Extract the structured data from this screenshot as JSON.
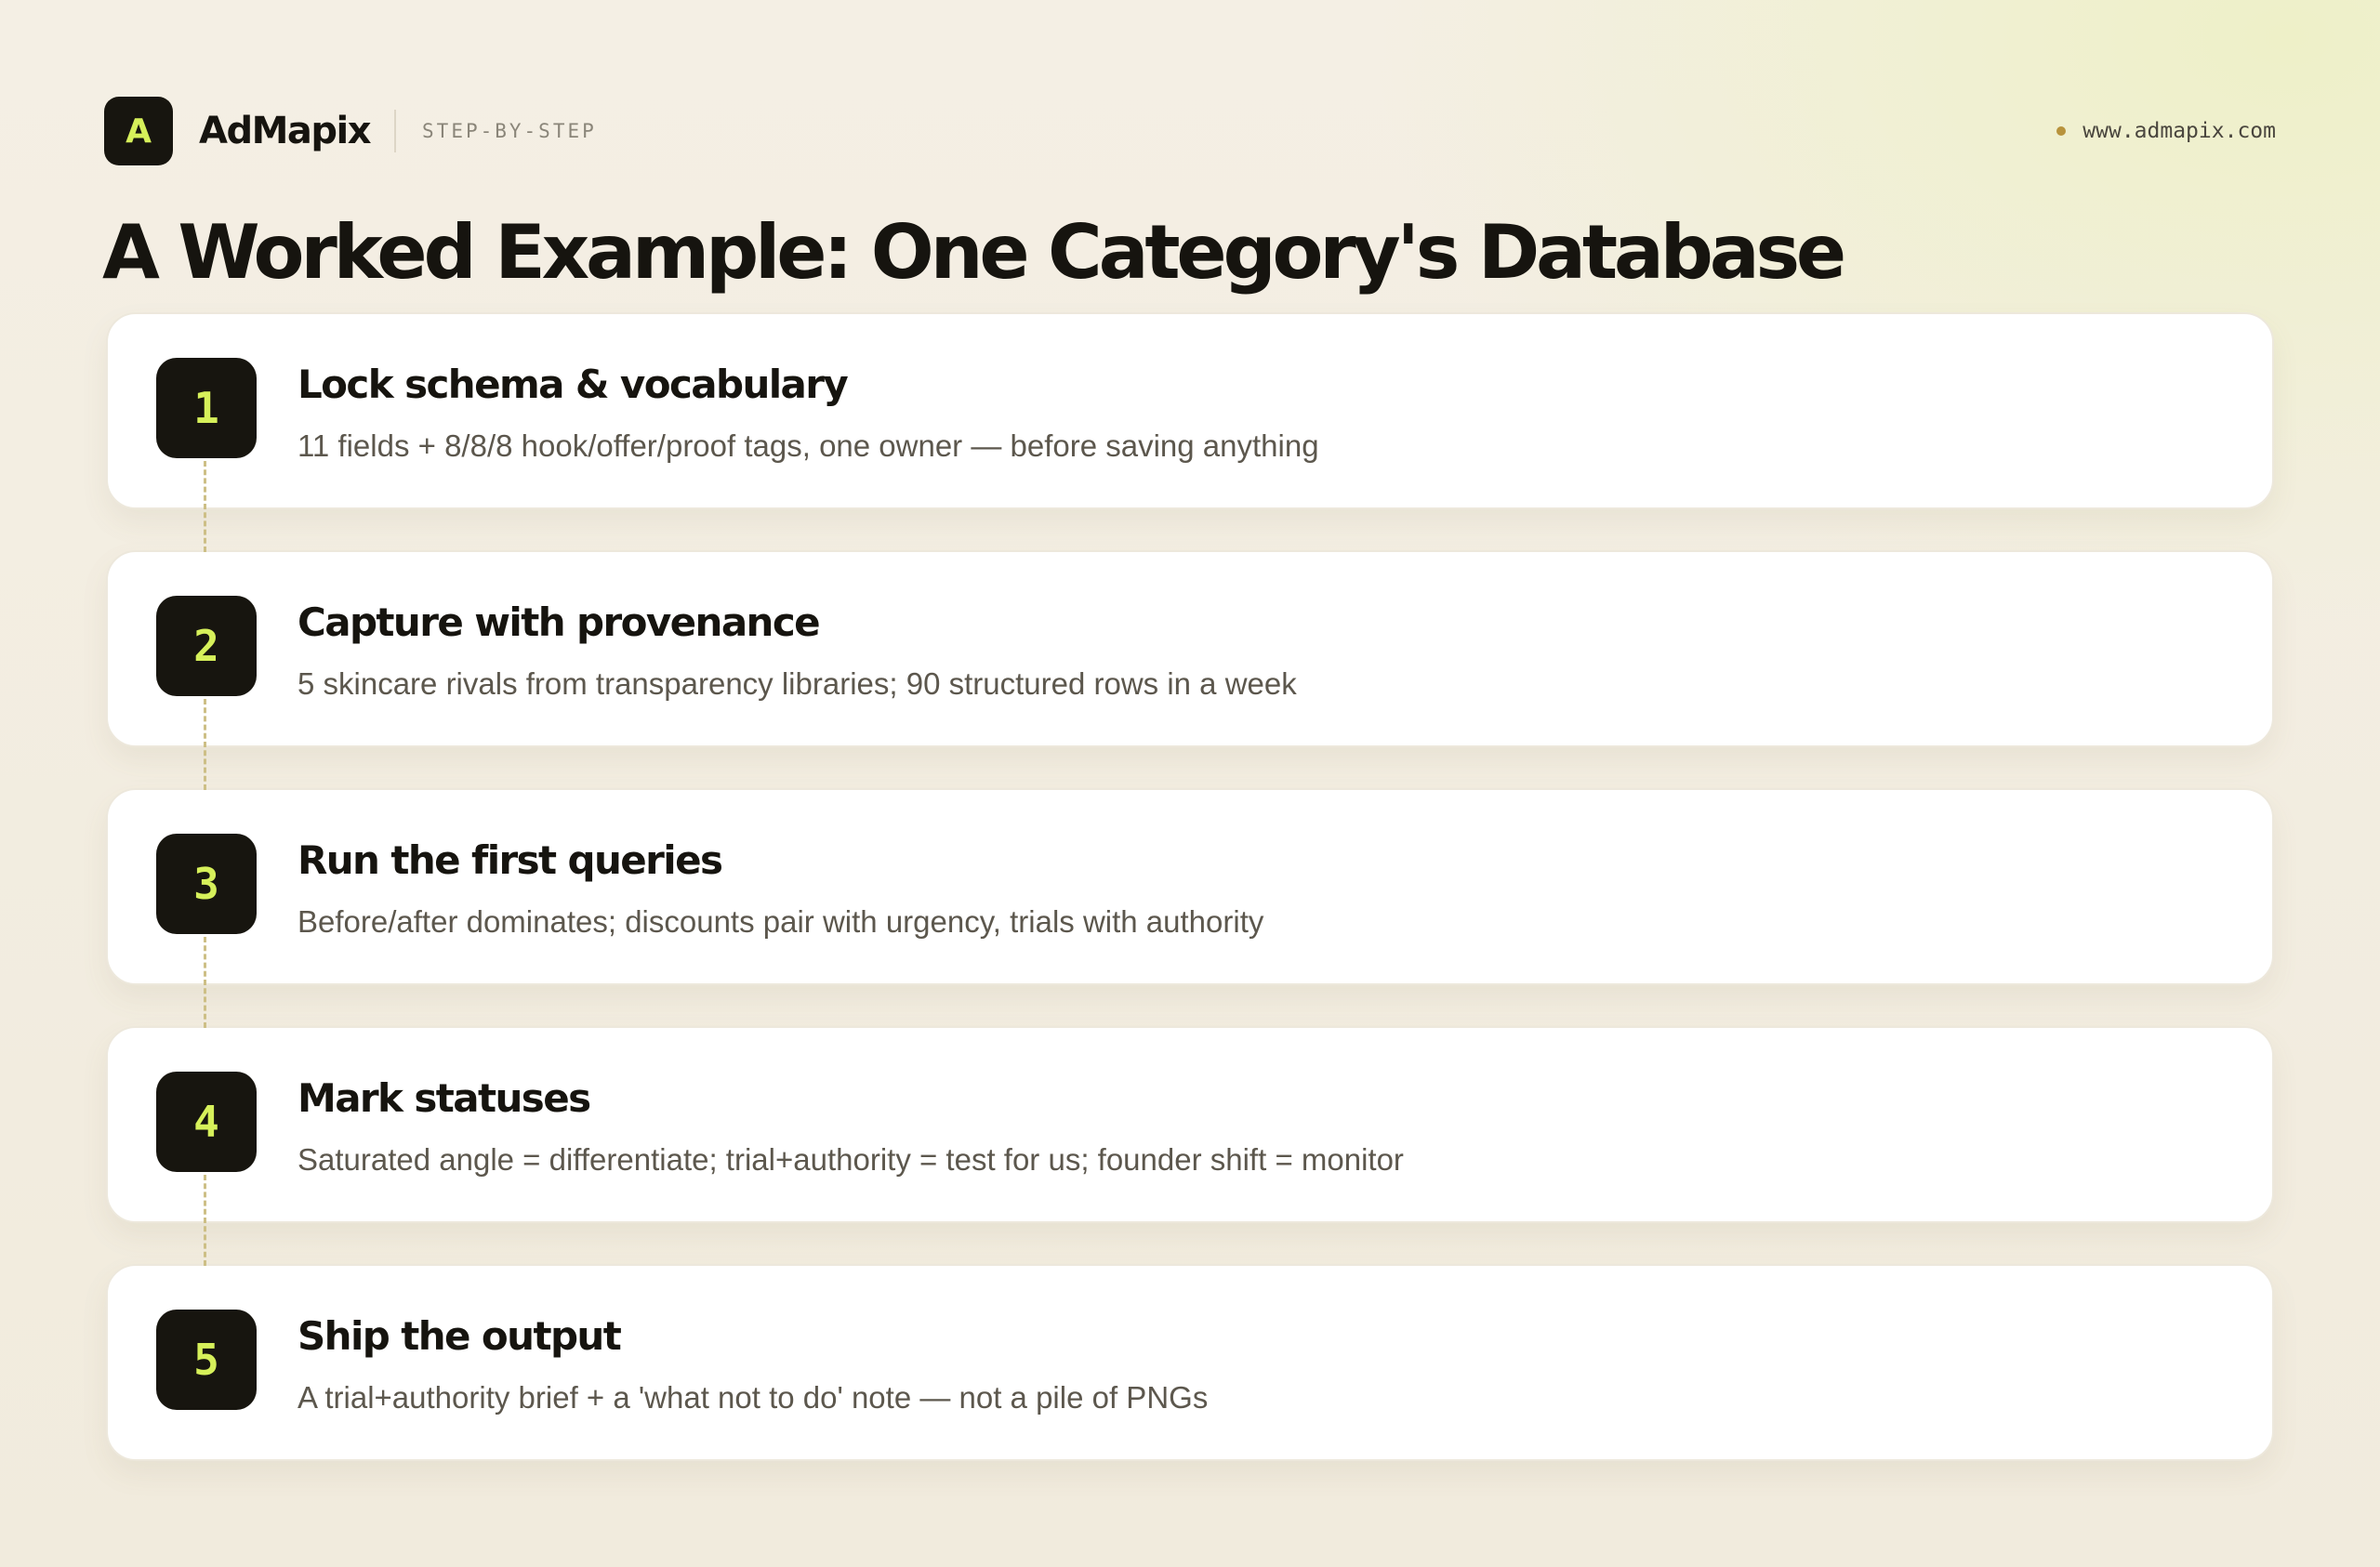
{
  "header": {
    "logo_letter": "A",
    "brand": "AdMapix",
    "section_tag": "STEP-BY-STEP",
    "site_url": "www.admapix.com"
  },
  "page_title": "A Worked Example: One Category's Database",
  "steps": [
    {
      "number": "1",
      "title": "Lock schema & vocabulary",
      "description": "11 fields + 8/8/8 hook/offer/proof tags, one owner — before saving anything"
    },
    {
      "number": "2",
      "title": "Capture with provenance",
      "description": "5 skincare rivals from transparency libraries; 90 structured rows in a week"
    },
    {
      "number": "3",
      "title": "Run the first queries",
      "description": "Before/after dominates; discounts pair with urgency, trials with authority"
    },
    {
      "number": "4",
      "title": "Mark statuses",
      "description": "Saturated angle = differentiate; trial+authority = test for us; founder shift = monitor"
    },
    {
      "number": "5",
      "title": "Ship the output",
      "description": "A trial+authority brief + a 'what not to do' note — not a pile of PNGs"
    }
  ],
  "colors": {
    "accent": "#d6f05a",
    "dark": "#17150f",
    "dot": "#b8933c",
    "connector": "#cdbf86"
  }
}
